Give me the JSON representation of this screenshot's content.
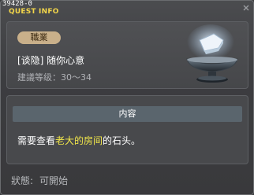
{
  "window": {
    "id": "39428-0",
    "title": "QUEST INFO"
  },
  "quest": {
    "job_badge": "職業",
    "name": "[谈隐] 随你心意",
    "level_label": "建議等级：",
    "level_range": "30～34"
  },
  "content": {
    "header": "内容",
    "text_before": "需要查看",
    "text_highlight": "老大的房间",
    "text_after": "的石头。",
    "highlight_color": "#f3e84a"
  },
  "status": {
    "label": "狀態:",
    "value": "可開始"
  },
  "icons": {
    "quest": "stone-on-pedestal-icon",
    "close": "close-icon"
  }
}
